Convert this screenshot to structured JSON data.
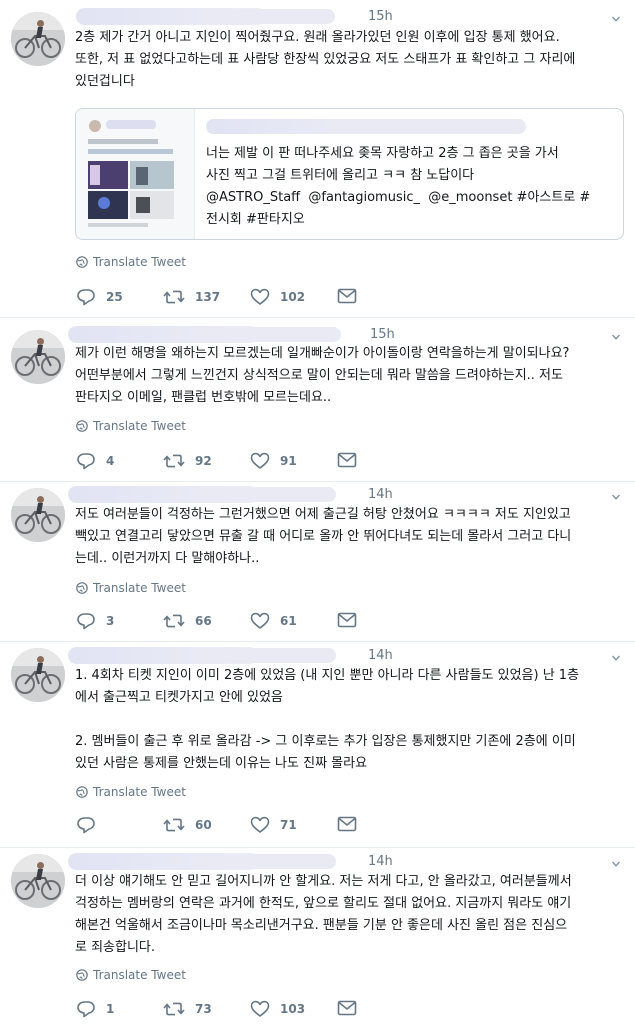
{
  "tweets": [
    {
      "time": "15h",
      "text": "2층 제가 간거 아니고 지인이 찍어줬구요. 원래 올라가있던 인원 이후에 입장 통제 했어요.\n또한, 저 표 없었다고하는데 표 사람당 한장씩 있었궁요 저도 스태프가 표 확인하고 그 자리에\n있던겁니다",
      "translate": "Translate Tweet",
      "replies": "25",
      "retweets": "137",
      "likes": "102"
    },
    {
      "time": "15h",
      "text": "제가 이런 해명을 왜하는지 모르겠는데 일개빠순이가 아이돌이랑 연락을하는게 말이되나요?\n어떤부분에서 그렇게 느낀건지 상식적으로 말이 안되는데 뭐라 말씀을 드려야하는지.. 저도\n판타지오 이메일, 팬클럽 번호밖에 모르는데요..",
      "translate": "Translate Tweet",
      "replies": "4",
      "retweets": "92",
      "likes": "91"
    },
    {
      "time": "14h",
      "text": "저도 여러분들이 걱정하는 그런거했으면 어제 출근길 허탕 안쳤어요 ㅋㅋㅋㅋ 저도 지인있고\n빽있고 연결고리 닿았으면 뮤출 갈 때 어디로 올까 안 뛰어다녀도 되는데 몰라서 그러고 다니\n는데.. 이런거까지 다 말해야하나..",
      "translate": "Translate Tweet",
      "replies": "3",
      "retweets": "66",
      "likes": "61"
    },
    {
      "time": "14h",
      "text": "1. 4회차 티켓 지인이 이미 2층에 있었음 (내 지인 뿐만 아니라 다른 사람들도 있었음) 난 1층\n에서 출근찍고 티켓가지고 안에 있었음\n\n2. 멤버들이 출근 후 위로 올라감 -> 그 이후로는 추가 입장은 통제했지만 기존에 2층에 이미\n있던 사람은 통제를 안했는데 이유는 나도 진짜 몰라요",
      "translate": "Translate Tweet",
      "replies": "",
      "retweets": "60",
      "likes": "71"
    },
    {
      "time": "14h",
      "text": "더 이상 얘기해도 안 믿고 길어지니까 안 할게요. 저는 저게 다고, 안 올라갔고, 여러분들께서\n걱정하는 멤버랑의 연락은 과거에 한적도, 앞으로 할리도 절대 없어요. 지금까지 뭐라도 얘기\n해본건 억울해서 조금이나마 목소리낸거구요. 팬분들 기분 안 좋은데 사진 올린 점은 진심으\n로 죄송합니다.",
      "translate": "Translate Tweet",
      "replies": "1",
      "retweets": "73",
      "likes": "103"
    }
  ],
  "quote": {
    "text": "너는 제발 이 판 떠나주세요 좆목 자랑하고 2층 그 좁은 곳을 가서\n사진 찍고 그걸 트위터에 올리고 ㅋㅋ 참 노답이다\n@ASTRO_Staff  @fantagiomusic_  @e_moonset #아스트로 #\n전시회 #판타지오"
  },
  "colors": {
    "text": "#14171a",
    "meta": "#657786",
    "border": "#e6ecf0",
    "redacted": "#e4e5f4"
  }
}
